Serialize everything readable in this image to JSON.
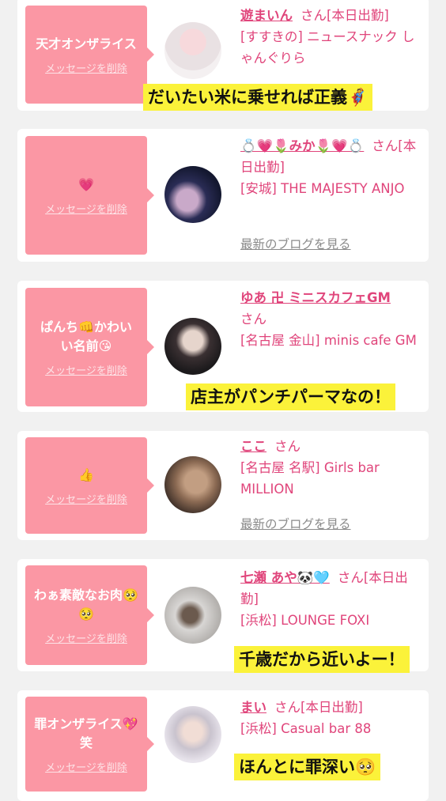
{
  "cards": [
    {
      "message": "天才オンザライス",
      "delete_label": "メッセージを削除",
      "name": "遊まいん",
      "honorific": "さん",
      "status": "[本日出勤]",
      "shop": "[すすきの] ニュースナック しゃんぐりら",
      "blog": "",
      "caption": "だいたい米に乗せれば正義🦸"
    },
    {
      "message": "💗",
      "delete_label": "メッセージを削除",
      "name": "💍💗🌷みか🌷💗💍",
      "honorific": "さん",
      "status": "[本日出勤]",
      "shop": "[安城] THE MAJESTY ANJO",
      "blog": "最新のブログを見る",
      "caption": ""
    },
    {
      "message": "ぱんち👊かわいい名前😘",
      "delete_label": "メッセージを削除",
      "name": "ゆあ 卍 ミニスカフェGM",
      "honorific": "さん",
      "status": "",
      "shop": "[名古屋 金山] minis cafe GM",
      "blog": "",
      "caption": "店主がパンチパーマなの！"
    },
    {
      "message": "👍",
      "delete_label": "メッセージを削除",
      "name": "ここ",
      "honorific": "さん",
      "status": "",
      "shop": "[名古屋 名駅] Girls bar MILLION",
      "blog": "最新のブログを見る",
      "caption": ""
    },
    {
      "message": "わぁ素敵なお肉🥺🥺",
      "delete_label": "メッセージを削除",
      "name": "七瀬 あや🐼🩵",
      "honorific": "さん",
      "status": "[本日出勤]",
      "shop": "[浜松] LOUNGE FOXI",
      "blog": "",
      "caption": "千歳だから近いよー！"
    },
    {
      "message": "罪オンザライス💖笑",
      "delete_label": "メッセージを削除",
      "name": "まい",
      "honorific": "さん",
      "status": "[本日出勤]",
      "shop": "[浜松] Casual bar 88",
      "blog": "",
      "caption": "ほんとに罪深い🥺"
    }
  ]
}
